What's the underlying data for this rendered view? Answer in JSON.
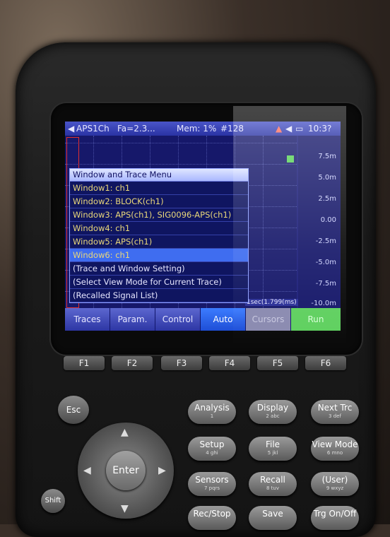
{
  "statusbar": {
    "title": "APS1Ch",
    "fa": "Fa=2.3...",
    "mem": "Mem: 1%",
    "index": "#128",
    "clock": "10:3?"
  },
  "plot": {
    "y_ticks": [
      "7.5m",
      "5.0m",
      "2.5m",
      "0.00",
      "-2.5m",
      "-5.0m",
      "-7.5m",
      "-10.0m"
    ],
    "time_readout": "1sec(1.799(ms)"
  },
  "menu": {
    "title": "Window and Trace Menu",
    "items": [
      {
        "label": "Window1: ch1",
        "kind": "window",
        "selected": false
      },
      {
        "label": "Window2: BLOCK(ch1)",
        "kind": "window",
        "selected": false
      },
      {
        "label": "Window3: APS(ch1), SIG0096-APS(ch1)",
        "kind": "window",
        "selected": false
      },
      {
        "label": "Window4: ch1",
        "kind": "window",
        "selected": false
      },
      {
        "label": "Window5: APS(ch1)",
        "kind": "window",
        "selected": false
      },
      {
        "label": "Window6: ch1",
        "kind": "window",
        "selected": true
      },
      {
        "label": "(Trace and Window Setting)",
        "kind": "other",
        "selected": false
      },
      {
        "label": "(Select View Mode for Current Trace)",
        "kind": "other",
        "selected": false
      },
      {
        "label": "(Recalled Signal List)",
        "kind": "other",
        "selected": false
      }
    ]
  },
  "softkeys": [
    "Traces",
    "Param.",
    "Control",
    "Auto",
    "Cursors",
    "Run"
  ],
  "fkeys": [
    "F1",
    "F2",
    "F3",
    "F4",
    "F5",
    "F6"
  ],
  "hardware": {
    "esc": "Esc",
    "shift": "Shift",
    "enter": "Enter",
    "buttons": [
      {
        "label": "Analysis",
        "sub": "1"
      },
      {
        "label": "Display",
        "sub": "2  abc"
      },
      {
        "label": "Next Trc",
        "sub": "3  def"
      },
      {
        "label": "Setup",
        "sub": "4  ghi"
      },
      {
        "label": "File",
        "sub": "5  jkl"
      },
      {
        "label": "View Mode",
        "sub": "6  mno"
      },
      {
        "label": "Sensors",
        "sub": "7  pqrs"
      },
      {
        "label": "Recall",
        "sub": "8  tuv"
      },
      {
        "label": "(User)",
        "sub": "9  wxyz"
      },
      {
        "label": "Rec/Stop",
        "sub": ""
      },
      {
        "label": "Save",
        "sub": ""
      },
      {
        "label": "Trg On/Off",
        "sub": ""
      }
    ]
  },
  "colors": {
    "screen_bg": "#1d1f7a",
    "menu_window_text": "#e9d77a",
    "selection": "#3f6df0",
    "run_key": "#5fd05f"
  }
}
